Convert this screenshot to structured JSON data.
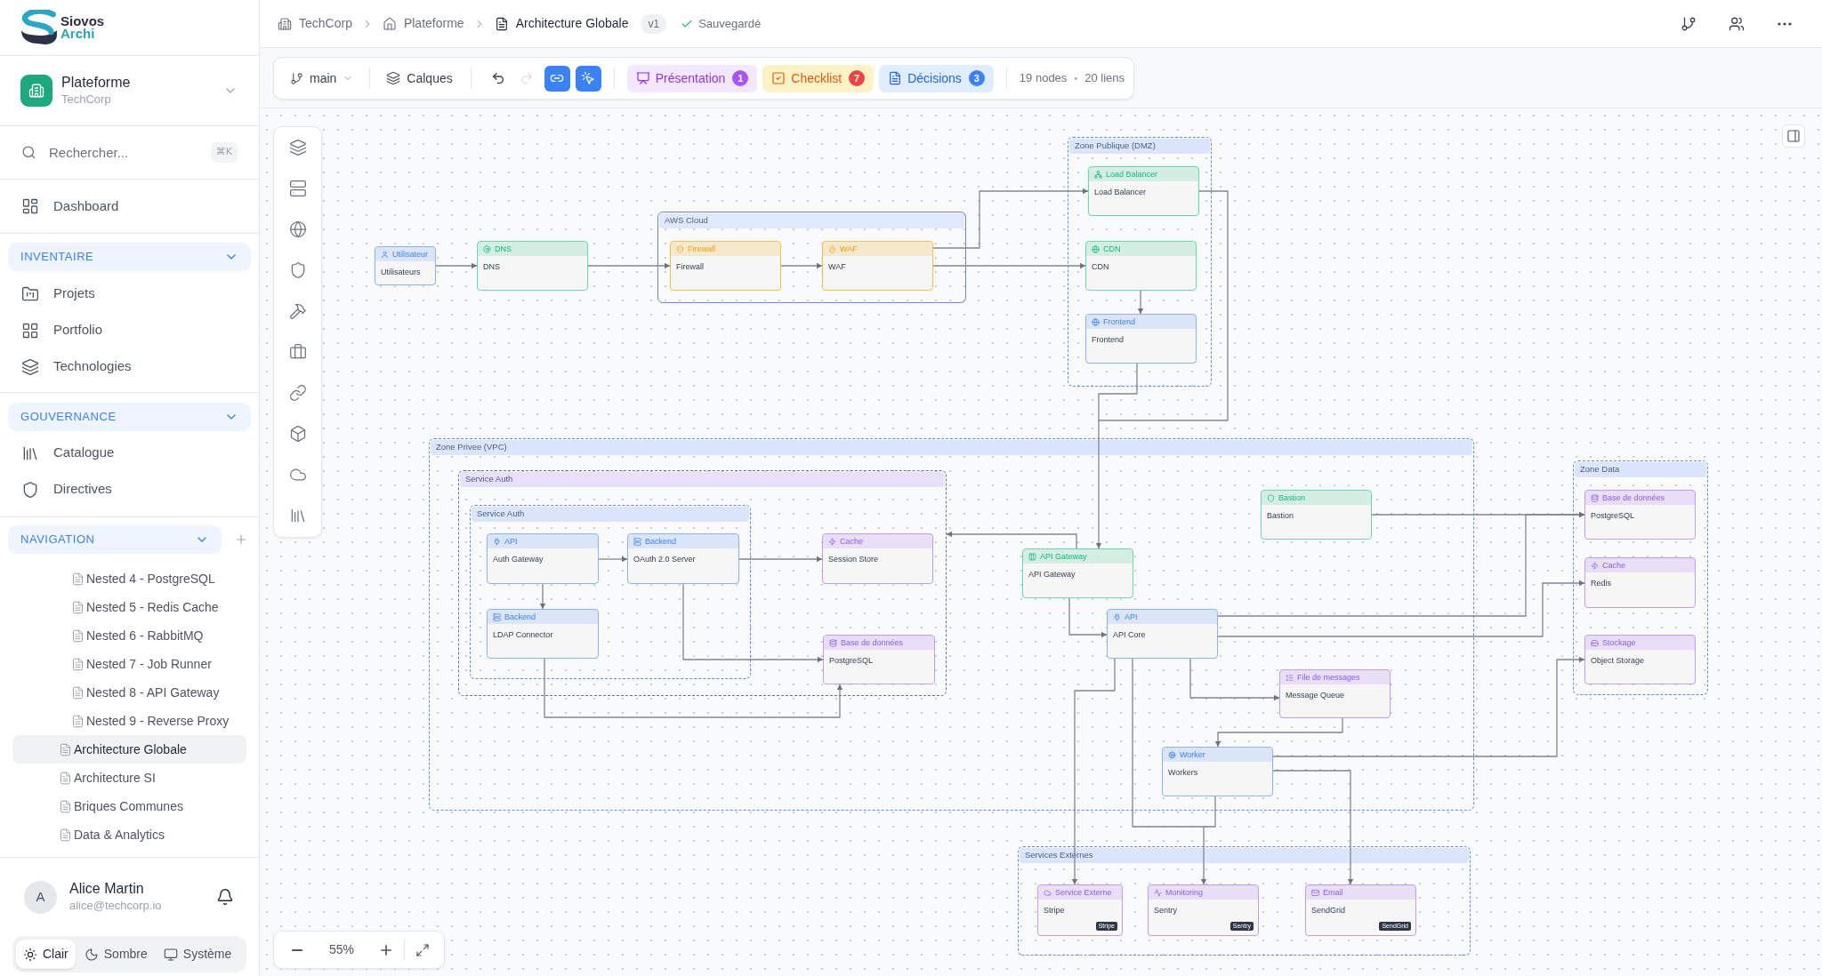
{
  "brand": {
    "name": "Siovos",
    "subtitle": "Archi"
  },
  "workspace": {
    "name": "Plateforme",
    "organization": "TechCorp"
  },
  "search": {
    "placeholder": "Rechercher...",
    "shortcut": "⌘K"
  },
  "menu": [
    {
      "label": "Dashboard",
      "selected": false
    }
  ],
  "sections": [
    {
      "title": "INVENTAIRE",
      "expanded": true,
      "items": [
        {
          "label": "Projets",
          "selected": false
        },
        {
          "label": "Portfolio",
          "selected": false
        },
        {
          "label": "Technologies",
          "selected": false
        }
      ]
    },
    {
      "title": "GOUVERNANCE",
      "expanded": true,
      "items": [
        {
          "label": "Catalogue",
          "selected": false
        },
        {
          "label": "Directives",
          "selected": false
        }
      ]
    }
  ],
  "navigation": {
    "title": "NAVIGATION",
    "expanded": true,
    "items": [
      {
        "children": [
          {
            "label": "Nested 4 - PostgreSQL",
            "selected": false
          },
          {
            "label": "Nested 5 - Redis Cache",
            "selected": false
          },
          {
            "label": "Nested 6 - RabbitMQ",
            "selected": false
          },
          {
            "label": "Nested 7 - Job Runner",
            "selected": false
          },
          {
            "label": "Nested 8 - API Gateway",
            "selected": false
          },
          {
            "label": "Nested 9 - Reverse Proxy",
            "selected": false
          }
        ]
      },
      {
        "label": "Architecture Globale",
        "selected": true
      },
      {
        "label": "Architecture SI",
        "selected": false
      },
      {
        "label": "Briques Communes",
        "selected": false
      },
      {
        "label": "Data & Analytics",
        "selected": false
      }
    ]
  },
  "user": {
    "initial": "A",
    "name": "Alice Martin",
    "email": "alice@techcorp.io"
  },
  "theme_options": [
    {
      "label": "Clair",
      "selected": true
    },
    {
      "label": "Sombre",
      "selected": false
    },
    {
      "label": "Système",
      "selected": false
    }
  ],
  "breadcrumb": [
    "TechCorp",
    "Plateforme",
    "Architecture Globale"
  ],
  "version": "v1",
  "save_status": "Sauvegardé",
  "toolbar": {
    "branch": "main",
    "layers_label": "Calques",
    "history": [
      {
        "kind": "undo",
        "disabled": false
      },
      {
        "kind": "redo",
        "disabled": true
      }
    ],
    "tools": [
      {
        "kind": "link",
        "on": true
      },
      {
        "kind": "select",
        "on": true
      }
    ],
    "panels": [
      {
        "kind": "presentation",
        "label": "Présentation",
        "count": "1",
        "color": "#f3e8ff"
      },
      {
        "kind": "checklist",
        "label": "Checklist",
        "count": "7",
        "color": "#fef3c7"
      },
      {
        "kind": "decisions",
        "label": "Décisions",
        "count": "3",
        "color": "#e0ecff"
      }
    ],
    "node_count": "19 nodes",
    "separator": "•",
    "link_count": "20 liens"
  },
  "zoom": {
    "reading": "55%"
  },
  "diagram": {
    "groups": [
      {
        "kind": "zone",
        "label": "Zone Publique (DMZ)"
      },
      {
        "kind": "cloud",
        "label": "AWS Cloud"
      },
      {
        "kind": "zone",
        "label": "Zone Privee (VPC)"
      },
      {
        "kind": "service",
        "label": "Service Auth"
      },
      {
        "kind": "zone",
        "label": "Service Auth"
      },
      {
        "kind": "zone",
        "label": "Zone Data"
      },
      {
        "kind": "zone",
        "label": "Services Externes"
      }
    ],
    "nodes": [
      {
        "kind": "user",
        "type_label": "Utilisateur",
        "label": "Utilisateurs",
        "color": "#8ab4f8"
      },
      {
        "kind": "dns",
        "type_label": "DNS",
        "label": "DNS",
        "color": "#6fd6aa"
      },
      {
        "kind": "firewall",
        "type_label": "Firewall",
        "label": "Firewall",
        "color": "#f7c04a"
      },
      {
        "kind": "waf",
        "type_label": "WAF",
        "label": "WAF",
        "color": "#f7c04a"
      },
      {
        "kind": "balancer",
        "type_label": "Load Balancer",
        "label": "Load Balancer",
        "color": "#6fd6aa"
      },
      {
        "kind": "cdn",
        "type_label": "CDN",
        "label": "CDN",
        "color": "#6fd6aa"
      },
      {
        "kind": "frontend",
        "type_label": "Frontend",
        "label": "Frontend",
        "color": "#8ab4f8"
      },
      {
        "kind": "api",
        "type_label": "API",
        "label": "Auth Gateway",
        "color": "#8ab4f8"
      },
      {
        "kind": "backend",
        "type_label": "Backend",
        "label": "OAuth 2.0 Server",
        "color": "#8ab4f8"
      },
      {
        "kind": "backend",
        "type_label": "Backend",
        "label": "LDAP Connector",
        "color": "#8ab4f8"
      },
      {
        "kind": "cache",
        "type_label": "Cache",
        "label": "Session Store",
        "color": "#c09cf5"
      },
      {
        "kind": "database",
        "type_label": "Base de données",
        "label": "PostgreSQL",
        "color": "#c09cf5"
      },
      {
        "kind": "bastion",
        "type_label": "Bastion",
        "label": "Bastion",
        "color": "#6fd6aa"
      },
      {
        "kind": "gateway",
        "type_label": "API Gateway",
        "label": "API Gateway",
        "color": "#6fd6aa"
      },
      {
        "kind": "api",
        "type_label": "API",
        "label": "API Core",
        "color": "#8ab4f8"
      },
      {
        "kind": "queue",
        "type_label": "File de messages",
        "label": "Message Queue",
        "color": "#c09cf5"
      },
      {
        "kind": "worker",
        "type_label": "Worker",
        "label": "Workers",
        "color": "#8ab4f8"
      },
      {
        "kind": "database",
        "type_label": "Base de données",
        "label": "PostgreSQL",
        "color": "#c09cf5"
      },
      {
        "kind": "cache",
        "type_label": "Cache",
        "label": "Redis",
        "color": "#c09cf5"
      },
      {
        "kind": "storage",
        "type_label": "Stockage",
        "label": "Object Storage",
        "color": "#c09cf5"
      },
      {
        "kind": "external",
        "type_label": "Service Externe",
        "label": "Stripe",
        "badge": "Stripe",
        "color": "#c09cf5"
      },
      {
        "kind": "monitoring",
        "type_label": "Monitoring",
        "label": "Sentry",
        "badge": "Sentry",
        "color": "#c09cf5"
      },
      {
        "kind": "email",
        "type_label": "Email",
        "label": "SendGrid",
        "badge": "SendGrid",
        "color": "#c09cf5"
      }
    ]
  }
}
